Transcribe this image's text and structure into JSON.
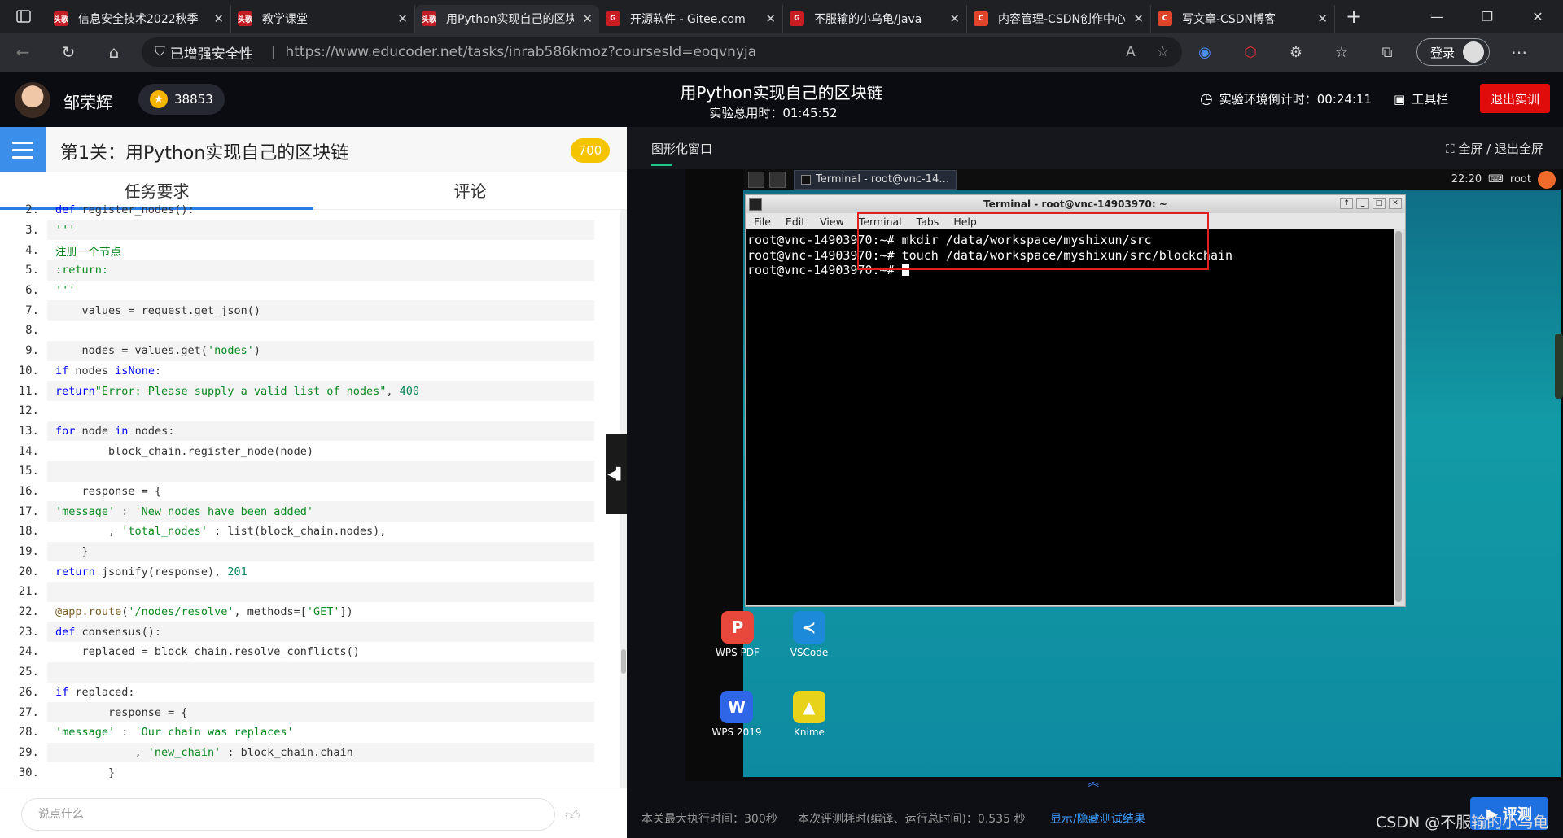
{
  "browser": {
    "tabs": [
      {
        "title": "信息安全技术2022秋季",
        "favicon": "头歌",
        "active": false
      },
      {
        "title": "教学课堂",
        "favicon": "头歌",
        "active": false
      },
      {
        "title": "用Python实现自己的区块链",
        "favicon": "头歌",
        "active": true
      },
      {
        "title": "开源软件 - Gitee.com",
        "favicon": "G",
        "active": false
      },
      {
        "title": "不服输的小乌龟/Java",
        "favicon": "G",
        "active": false
      },
      {
        "title": "内容管理-CSDN创作中心",
        "favicon": "C",
        "active": false
      },
      {
        "title": "写文章-CSDN博客",
        "favicon": "C",
        "active": false
      }
    ],
    "security_label": "已增强安全性",
    "url": "https://www.educoder.net/tasks/inrab586kmoz?coursesId=eoqvnyja",
    "login_label": "登录"
  },
  "header": {
    "username": "邹荣辉",
    "coins": "38853",
    "title": "用Python实现自己的区块链",
    "total_time": "实验总用时：01:45:52",
    "countdown": "实验环境倒计时：00:24:11",
    "toolbar_label": "工具栏",
    "exit_label": "退出实训"
  },
  "left": {
    "level_title": "第1关：用Python实现自己的区块链",
    "level_score": "700",
    "tabs": [
      "任务要求",
      "评论"
    ],
    "comment_placeholder": "说点什么"
  },
  "code_lines": [
    {
      "n": "2.",
      "html": "<span class=\"kw\">def</span> register_nodes():"
    },
    {
      "n": "3.",
      "html": "    <span class=\"st\">'''</span>"
    },
    {
      "n": "4.",
      "html": "    <span class=\"cm\">注册一个节点</span>"
    },
    {
      "n": "5.",
      "html": "    <span class=\"cm\">:return:</span>"
    },
    {
      "n": "6.",
      "html": "    <span class=\"st\">'''</span>"
    },
    {
      "n": "7.",
      "html": "    values = request.get_json()"
    },
    {
      "n": "8.",
      "html": ""
    },
    {
      "n": "9.",
      "html": "    nodes = values.get(<span class=\"st\">'nodes'</span>)"
    },
    {
      "n": "10.",
      "html": "    <span class=\"kw\">if</span> nodes <span class=\"kw\">is</span> <span class=\"kw\">None</span>:"
    },
    {
      "n": "11.",
      "html": "        <span class=\"kw\">return</span> <span class=\"st\">\"Error: Please supply a valid list of nodes\"</span>, <span class=\"nm\">400</span>"
    },
    {
      "n": "12.",
      "html": ""
    },
    {
      "n": "13.",
      "html": "    <span class=\"kw\">for</span> node <span class=\"kw\">in</span> nodes:"
    },
    {
      "n": "14.",
      "html": "        block_chain.register_node(node)"
    },
    {
      "n": "15.",
      "html": ""
    },
    {
      "n": "16.",
      "html": "    response = {"
    },
    {
      "n": "17.",
      "html": "        <span class=\"st\">'message'</span> : <span class=\"st\">'New nodes have been added'</span>"
    },
    {
      "n": "18.",
      "html": "        , <span class=\"st\">'total_nodes'</span> : list(block_chain.nodes),"
    },
    {
      "n": "19.",
      "html": "    }"
    },
    {
      "n": "20.",
      "html": "    <span class=\"kw\">return</span> jsonify(response), <span class=\"nm\">201</span>"
    },
    {
      "n": "21.",
      "html": ""
    },
    {
      "n": "22.",
      "html": "<span class=\"dec\">@app.route</span>(<span class=\"st\">'/nodes/resolve'</span>, methods=[<span class=\"st\">'GET'</span>])"
    },
    {
      "n": "23.",
      "html": "<span class=\"kw\">def</span> consensus():"
    },
    {
      "n": "24.",
      "html": "    replaced = block_chain.resolve_conflicts()"
    },
    {
      "n": "25.",
      "html": ""
    },
    {
      "n": "26.",
      "html": "    <span class=\"kw\">if</span> replaced:"
    },
    {
      "n": "27.",
      "html": "        response = {"
    },
    {
      "n": "28.",
      "html": "            <span class=\"st\">'message'</span> : <span class=\"st\">'Our chain was replaces'</span>"
    },
    {
      "n": "29.",
      "html": "            , <span class=\"st\">'new_chain'</span> : block_chain.chain"
    },
    {
      "n": "30.",
      "html": "        }"
    }
  ],
  "right": {
    "tab_label": "图形化窗口",
    "fullscreen_label": "全屏 / 退出全屏",
    "taskbar_title": "Terminal - root@vnc-14…",
    "clock": "22:20",
    "user": "root",
    "terminal_title": "Terminal - root@vnc-14903970: ~",
    "terminal_menu": [
      "File",
      "Edit",
      "View",
      "Terminal",
      "Tabs",
      "Help"
    ],
    "terminal_lines": [
      "root@vnc-14903970:~# mkdir /data/workspace/myshixun/src",
      "root@vnc-14903970:~# touch /data/workspace/myshixun/src/blockchain",
      "root@vnc-14903970:~# "
    ],
    "desktop_icons": [
      {
        "label": "WPS PDF",
        "glyph": "P",
        "color": "#e8473c"
      },
      {
        "label": "VSCode",
        "glyph": "≺",
        "color": "#1c8ad8"
      },
      {
        "label": "WPS 2019",
        "glyph": "W",
        "color": "#2f66e8"
      },
      {
        "label": "Knime",
        "glyph": "▲",
        "color": "#e8d21a"
      }
    ],
    "status_max_time": "本关最大执行时间：300秒",
    "status_eval_time": "本次评测耗时(编译、运行总时间)：0.535 秒",
    "status_link": "显示/隐藏测试结果",
    "eval_label": "评测"
  },
  "watermark": "CSDN @不服输的小乌龟"
}
